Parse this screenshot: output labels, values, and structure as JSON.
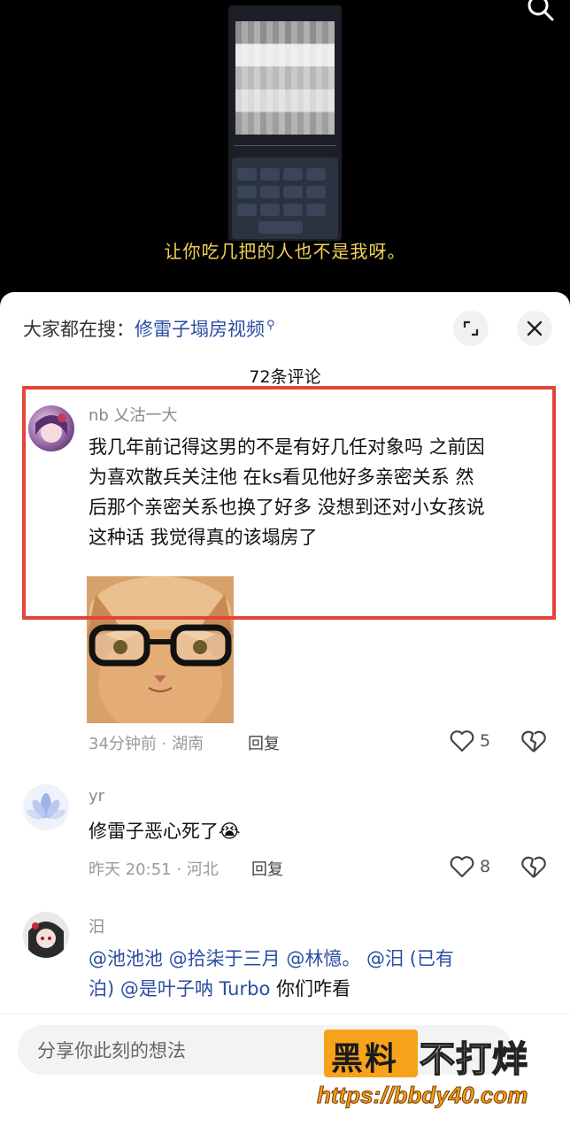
{
  "video": {
    "subtitle": "让你吃几把的人也不是我呀。",
    "phone_keys": [
      "词组",
      "话题",
      "老人",
      "外",
      "上",
      "子"
    ]
  },
  "search": {
    "prefix": "大家都在搜：",
    "keyword": "修雷子塌房视频"
  },
  "comments_count": "72条评论",
  "comments": [
    {
      "user": "nb 乂沽一大",
      "lines": [
        "我几年前记得这男的不是有好几任对象吗 之前因",
        "为喜欢散兵关注他 在ks看见他好多亲密关系 然",
        "后那个亲密关系也换了好多 没想到还对小女孩说",
        "这种话 我觉得真的该塌房了"
      ],
      "time_location": "34分钟前 · 湖南",
      "reply": "回复",
      "likes": "5"
    },
    {
      "user": "yr",
      "text": "修雷子恶心死了",
      "emoji": "😭",
      "time_location": "昨天 20:51 · 河北",
      "reply": "回复",
      "likes": "8"
    },
    {
      "user": "汨",
      "mentions_line1": "@池池池 @拾柒于三月 @林憶。 @汨 (已有",
      "mentions_line2_mention": "泊) @是叶子呐 Turbo",
      "mentions_line2_tail": " 你们咋看"
    }
  ],
  "input": {
    "placeholder": "分享你此刻的想法"
  },
  "watermark": {
    "brand_a": "黑料",
    "brand_b": "不打烊",
    "url": "https://bbdy40.com"
  },
  "colors": {
    "highlight": "#e4443b",
    "link": "#2a4ea1",
    "subtitle": "#f2d35a",
    "watermark": "#f7a21b"
  }
}
